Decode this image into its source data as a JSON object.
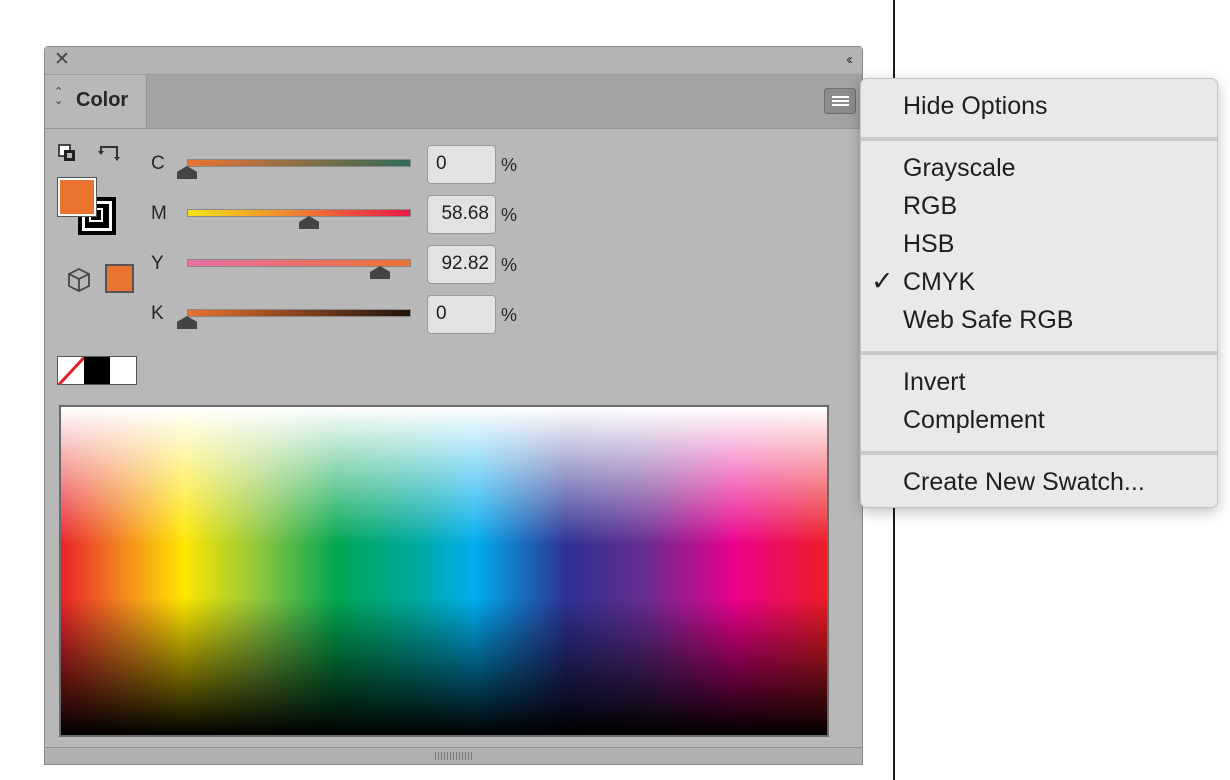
{
  "panel": {
    "close_glyph": "✕",
    "collapse_glyph": "‹‹",
    "tab_label": "Color",
    "tab_updown_glyph": "⌃⌄"
  },
  "colors": {
    "fill": "#eb7332",
    "stroke": "#000000",
    "panel_bg": "#b8b8b8",
    "menu_bg": "#e9e9e9"
  },
  "sliders": [
    {
      "label": "C",
      "value": "0",
      "unit": "%",
      "level": 0,
      "track_gradient": [
        "#eb7332",
        "#2f6b57"
      ]
    },
    {
      "label": "M",
      "value": "58.68",
      "unit": "%",
      "level": 0.5868,
      "track_gradient": [
        "#f5e21b",
        "#e8194a"
      ]
    },
    {
      "label": "Y",
      "value": "92.82",
      "unit": "%",
      "level": 0.9282,
      "track_gradient": [
        "#ea6fa6",
        "#eb7332"
      ]
    },
    {
      "label": "K",
      "value": "0",
      "unit": "%",
      "level": 0,
      "track_gradient": [
        "#eb7332",
        "#1f130a"
      ]
    }
  ],
  "icons": {
    "default_fill_stroke": "default-fill-stroke-icon",
    "swap": "swap-fill-stroke-icon",
    "gamut": "out-of-gamut-cube-icon",
    "menu": "panel-menu-icon"
  },
  "menu": {
    "groups": [
      [
        {
          "label": "Hide Options",
          "checked": false
        }
      ],
      [
        {
          "label": "Grayscale",
          "checked": false
        },
        {
          "label": "RGB",
          "checked": false
        },
        {
          "label": "HSB",
          "checked": false
        },
        {
          "label": "CMYK",
          "checked": true
        },
        {
          "label": "Web Safe RGB",
          "checked": false
        }
      ],
      [
        {
          "label": "Invert",
          "checked": false
        },
        {
          "label": "Complement",
          "checked": false
        }
      ],
      [
        {
          "label": "Create New Swatch...",
          "checked": false
        }
      ]
    ],
    "check_glyph": "✓"
  }
}
